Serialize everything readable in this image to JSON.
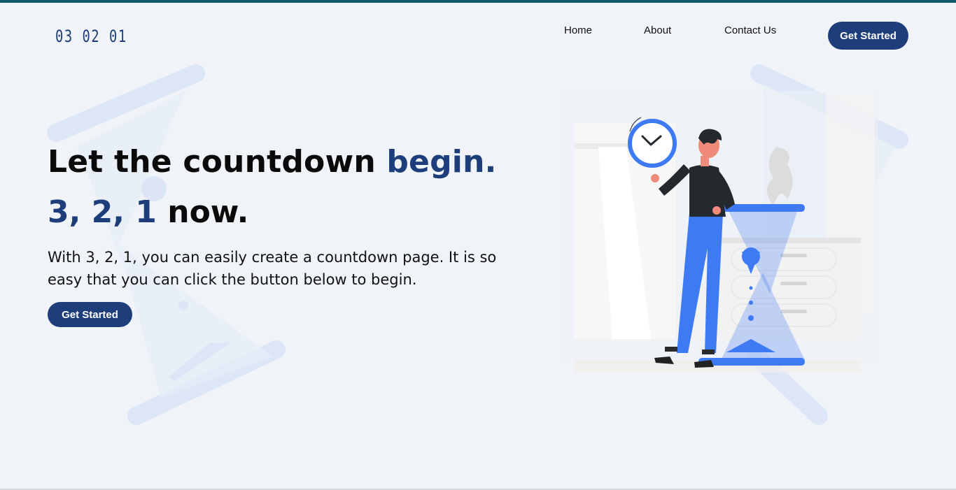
{
  "header": {
    "logo": "03 02 01",
    "nav": [
      {
        "label": "Home"
      },
      {
        "label": "About"
      },
      {
        "label": "Contact Us"
      }
    ],
    "cta_label": "Get Started"
  },
  "hero": {
    "title_part1": "Let the countdown ",
    "title_accent": "begin.",
    "subtitle_accent": "3, 2, 1",
    "subtitle_rest": " now.",
    "description": "With 3, 2, 1, you can easily create a countdown page. It is so easy that you can click the button below to begin.",
    "cta_label": "Get Started"
  },
  "colors": {
    "brand": "#1e3e7b",
    "accent_blue": "#3f7af5",
    "background": "#f0f3f8",
    "top_bar": "#0f5a6b"
  },
  "icons": {
    "background_left": "hourglass-icon",
    "background_right": "hourglass-icon",
    "clock": "clock-icon",
    "hourglass": "hourglass-icon"
  }
}
